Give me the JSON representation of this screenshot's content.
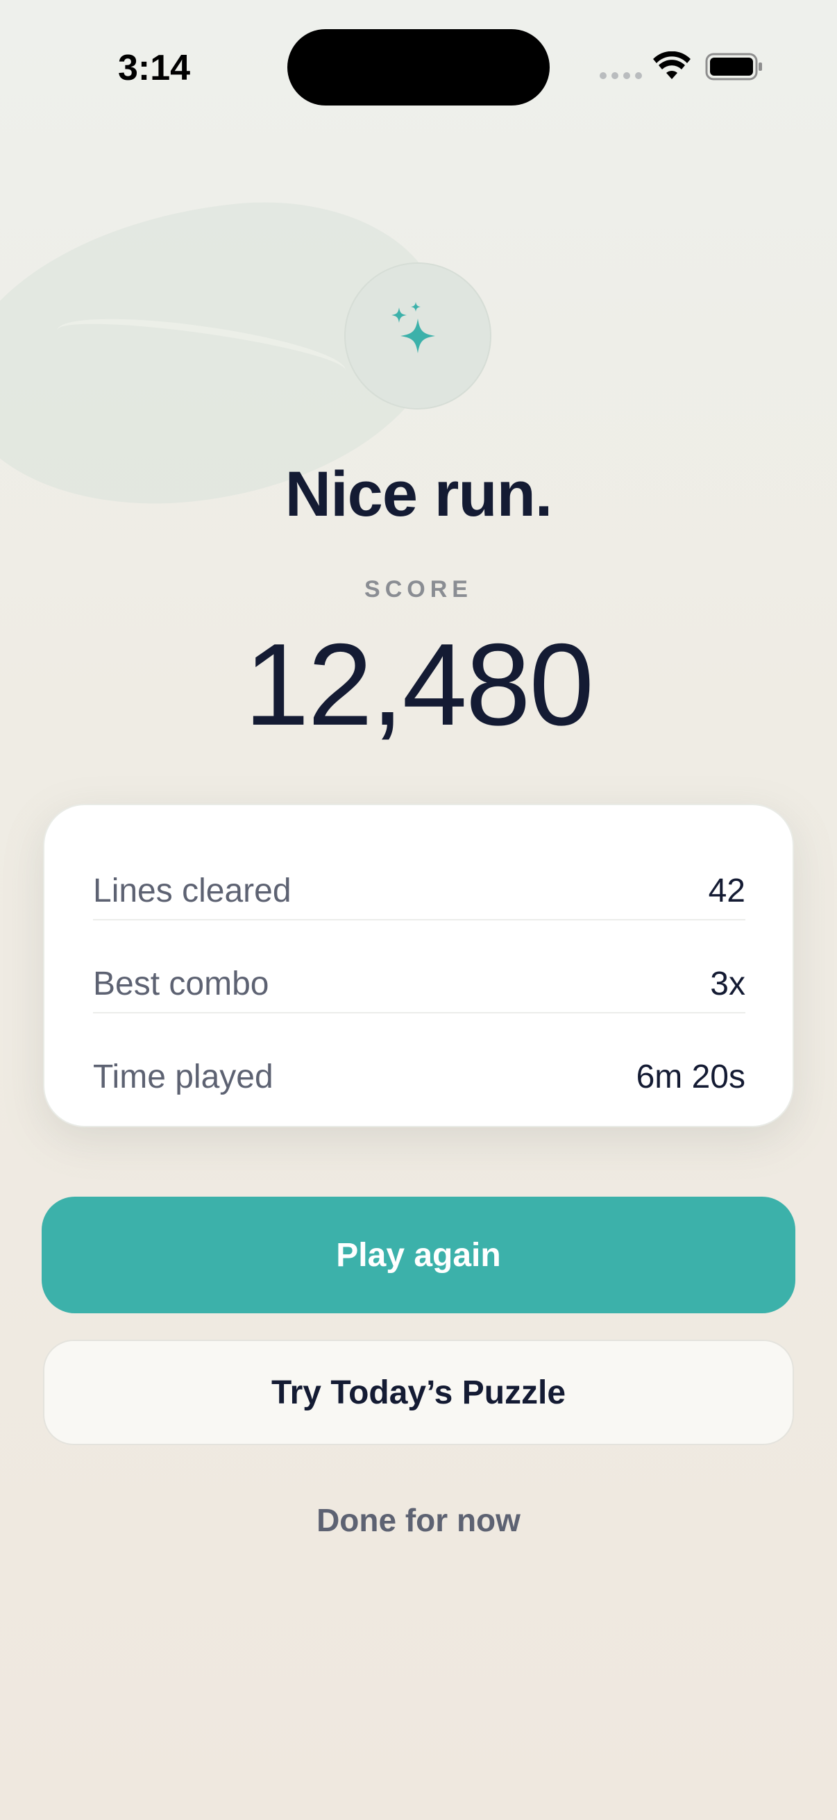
{
  "status_bar": {
    "time": "3:14"
  },
  "hero": {
    "icon": "sparkle-icon",
    "headline": "Nice run.",
    "score_label": "SCORE",
    "score_value": "12,480"
  },
  "stats": [
    {
      "label": "Lines cleared",
      "value": "42"
    },
    {
      "label": "Best combo",
      "value": "3x"
    },
    {
      "label": "Time played",
      "value": "6m 20s"
    }
  ],
  "actions": {
    "primary": "Play again",
    "secondary": "Try Today’s Puzzle",
    "tertiary": "Done for now"
  },
  "colors": {
    "accent": "#3cb1aa",
    "text": "#141b33",
    "muted": "#5d6272"
  }
}
